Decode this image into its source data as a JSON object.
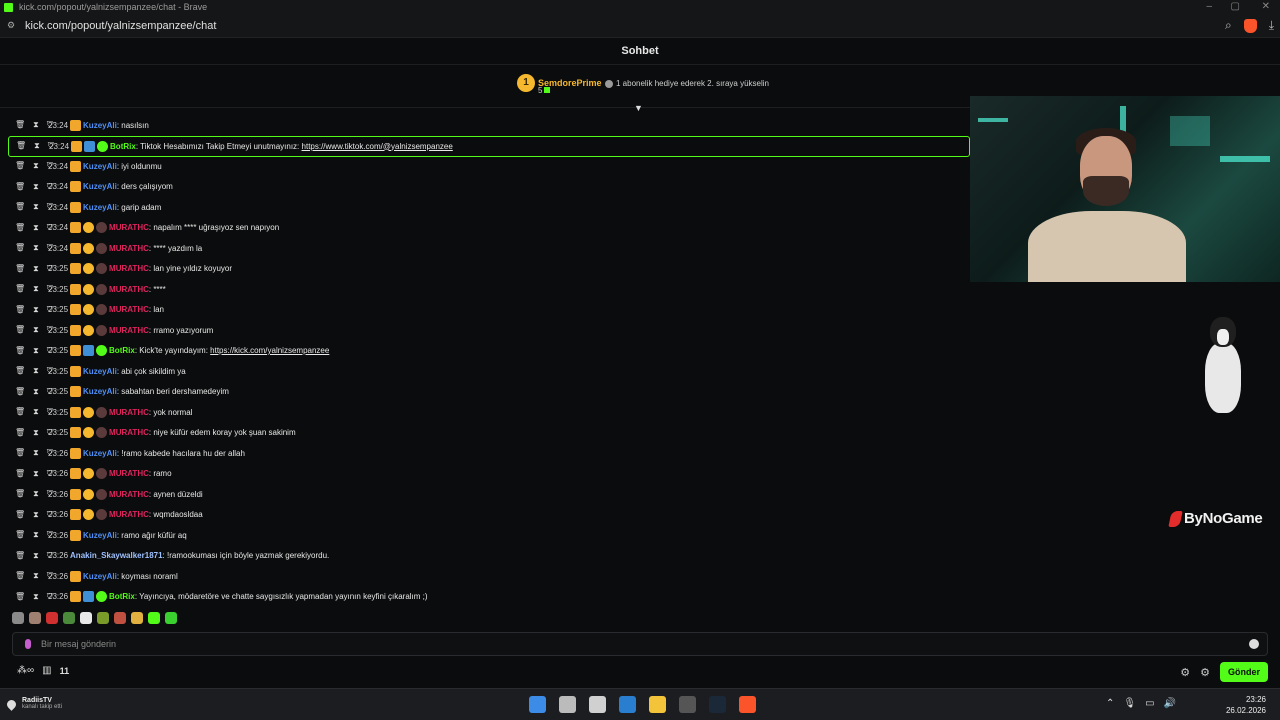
{
  "browser": {
    "window_title": "kick.com/popout/yalnizsempanzee/chat - Brave",
    "url": "kick.com/popout/yalnizsempanzee/chat"
  },
  "chat": {
    "header": "Sohbet",
    "pinned": {
      "rank": "1",
      "gifter_name": "SemdorePrime",
      "gift_count": "5",
      "prompt": "1 abonelik hediye ederek 2. sıraya yükselin"
    },
    "messages": [
      {
        "time": "23:24",
        "user": "KuzeyAli",
        "type": "kuzey",
        "text": ": nasılsın"
      },
      {
        "time": "23:24",
        "user": "BotRix",
        "type": "bot",
        "text": ": Tiktok Hesabımızı Takip Etmeyi unutmayınız: ",
        "link": "https://www.tiktok.com/@yalnizsempanzee"
      },
      {
        "time": "23:24",
        "user": "KuzeyAli",
        "type": "kuzey",
        "text": ": iyi oldunmu"
      },
      {
        "time": "23:24",
        "user": "KuzeyAli",
        "type": "kuzey",
        "text": ": ders çalışıyom"
      },
      {
        "time": "23:24",
        "user": "KuzeyAli",
        "type": "kuzey",
        "text": ": garip adam"
      },
      {
        "time": "23:24",
        "user": "MURATHC",
        "type": "murat",
        "text": ": napalım **** uğraşıyoz sen napıyon"
      },
      {
        "time": "23:24",
        "user": "MURATHC",
        "type": "murat",
        "text": ": **** yazdım la"
      },
      {
        "time": "23:25",
        "user": "MURATHC",
        "type": "murat",
        "text": ": lan yine yıldız koyuyor"
      },
      {
        "time": "23:25",
        "user": "MURATHC",
        "type": "murat",
        "text": ": ****"
      },
      {
        "time": "23:25",
        "user": "MURATHC",
        "type": "murat",
        "text": ": lan"
      },
      {
        "time": "23:25",
        "user": "MURATHC",
        "type": "murat",
        "text": ": rramo yazıyorum"
      },
      {
        "time": "23:25",
        "user": "BotRix",
        "type": "bot",
        "text": ": Kick'te yayındayım: ",
        "link": "https://kick.com/yalnizsempanzee"
      },
      {
        "time": "23:25",
        "user": "KuzeyAli",
        "type": "kuzey",
        "text": ": abi çok sikildim ya"
      },
      {
        "time": "23:25",
        "user": "KuzeyAli",
        "type": "kuzey",
        "text": ": sabahtan beri dershamedeyim"
      },
      {
        "time": "23:25",
        "user": "MURATHC",
        "type": "murat",
        "text": ": yok normal"
      },
      {
        "time": "23:25",
        "user": "MURATHC",
        "type": "murat",
        "text": ": niye küfür edem koray yok şuan sakinim"
      },
      {
        "time": "23:26",
        "user": "KuzeyAli",
        "type": "kuzey",
        "text": ": !ramo kabede hacılara hu der allah"
      },
      {
        "time": "23:26",
        "user": "MURATHC",
        "type": "murat",
        "text": ": ramo"
      },
      {
        "time": "23:26",
        "user": "MURATHC",
        "type": "murat",
        "text": ": aynen düzeldi"
      },
      {
        "time": "23:26",
        "user": "MURATHC",
        "type": "murat",
        "text": ": wqmdaosldaa"
      },
      {
        "time": "23:26",
        "user": "KuzeyAli",
        "type": "kuzey",
        "text": ": ramo ağır küfür aq"
      },
      {
        "time": "23:26",
        "user": "Anakin_Skaywalker1871",
        "type": "anakin",
        "text": ": !ramookuması için böyle yazmak gerekiyordu."
      },
      {
        "time": "23:26",
        "user": "KuzeyAli",
        "type": "kuzey",
        "text": ": koyması noraml"
      },
      {
        "time": "23:26",
        "user": "BotRix",
        "type": "bot",
        "text": ": Yayıncıya, mödaretöre ve chatte saygısızlık yapmadan yayının keyfini çıkaralım ;)"
      }
    ],
    "input_placeholder": "Bir mesaj gönderin",
    "footer": {
      "loop_icon": "∞",
      "viewer_count": "11",
      "send_label": "Gönder"
    }
  },
  "overlay": {
    "brand": "ByNoGame"
  },
  "taskbar": {
    "notif_title": "RadiisTV",
    "notif_sub": "kanalı takip etti",
    "time": "23:26",
    "date": "26.02.2026"
  },
  "colors": {
    "accent": "#53fc18",
    "kuzey": "#4f8ff7",
    "murat": "#e0245e",
    "gold": "#f5b82e"
  }
}
